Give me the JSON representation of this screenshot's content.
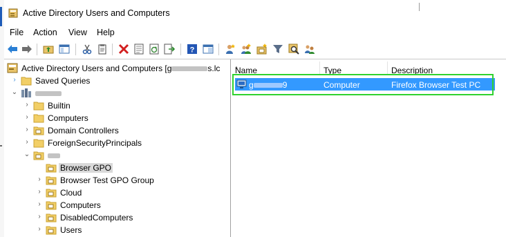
{
  "window": {
    "title": "Active Directory Users and Computers"
  },
  "menu": [
    "File",
    "Action",
    "View",
    "Help"
  ],
  "toolbar": {
    "buttons": [
      "back-arrow-icon",
      "forward-arrow-icon",
      "up-folder-icon",
      "show-hide-console-tree-icon",
      "cut-icon",
      "copy-icon",
      "delete-icon",
      "properties-icon",
      "refresh-icon",
      "export-list-icon",
      "help-icon",
      "console-view-icon",
      "new-user-icon",
      "new-group-icon",
      "new-ou-icon",
      "filter-icon",
      "find-icon",
      "add-to-group-icon"
    ]
  },
  "tree": {
    "root": {
      "label_prefix": "Active Directory Users and Computers [g",
      "label_suffix": "s.lc"
    },
    "saved_queries": "Saved Queries",
    "domain_children": [
      "Builtin",
      "Computers",
      "Domain Controllers",
      "ForeignSecurityPrincipals"
    ],
    "ou_children": [
      "Browser GPO",
      "Browser Test GPO Group",
      "Cloud",
      "Computers",
      "DisabledComputers",
      "Users"
    ],
    "selected": "Browser GPO"
  },
  "list": {
    "columns": [
      "Name",
      "Type",
      "Description"
    ],
    "rows": [
      {
        "name_prefix": "g",
        "name_suffix": "9",
        "type": "Computer",
        "description": "Firefox Browser Test PC"
      }
    ]
  },
  "colors": {
    "selection": "#3399ff",
    "highlight_box": "#2fd22f",
    "tree_selected": "#d9d9d9"
  }
}
